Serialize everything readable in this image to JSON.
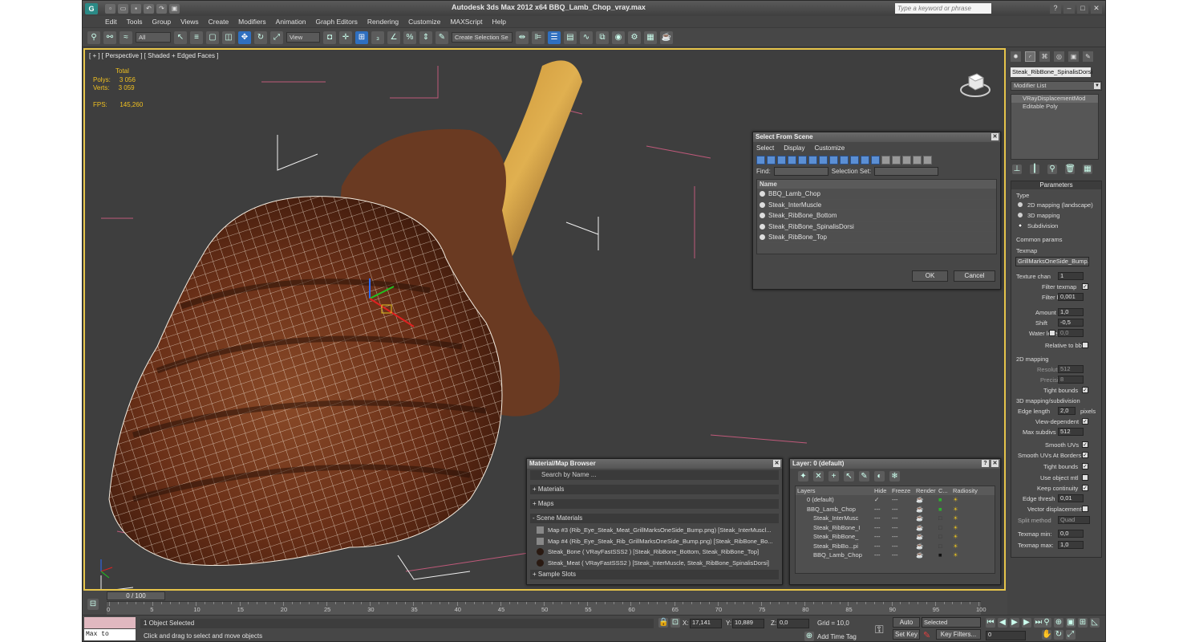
{
  "app": {
    "title": "Autodesk 3ds Max  2012 x64     BBQ_Lamb_Chop_vray.max",
    "search_placeholder": "Type a keyword or phrase",
    "logo_letter": "G"
  },
  "menu": [
    "Edit",
    "Tools",
    "Group",
    "Views",
    "Create",
    "Modifiers",
    "Animation",
    "Graph Editors",
    "Rendering",
    "Customize",
    "MAXScript",
    "Help"
  ],
  "toolbar": {
    "filter_select": "All",
    "ref_coord": "View",
    "named_selection": "Create Selection Se"
  },
  "viewport": {
    "label": "[ + ] [ Perspective ] [ Shaded + Edged Faces ]",
    "stats": {
      "total_label": "Total",
      "polys_label": "Polys:",
      "polys_value": "3 056",
      "verts_label": "Verts:",
      "verts_value": "3 059",
      "fps_label": "FPS:",
      "fps_value": "145,260"
    }
  },
  "select_from_scene": {
    "title": "Select From Scene",
    "menu": [
      "Select",
      "Display",
      "Customize"
    ],
    "find_label": "Find:",
    "selection_set_label": "Selection Set:",
    "column_name": "Name",
    "items": [
      "BBQ_Lamb_Chop",
      "Steak_InterMuscle",
      "Steak_RibBone_Bottom",
      "Steak_RibBone_SpinalisDorsi",
      "Steak_RibBone_Top"
    ],
    "ok": "OK",
    "cancel": "Cancel"
  },
  "material_browser": {
    "title": "Material/Map Browser",
    "search": "Search by Name ...",
    "groups": [
      "+ Materials",
      "+ Maps",
      "- Scene Materials"
    ],
    "scene_materials": [
      "Map #3 (Rib_Eye_Steak_Meat_GrillMarksOneSide_Bump.png) [Steak_InterMuscl...",
      "Map #4 (Rib_Eye_Steak_Rib_GrillMarksOneSide_Bump.png) [Steak_RibBone_Bo...",
      "Steak_Bone  ( VRayFastSSS2 )  [Steak_RibBone_Bottom, Steak_RibBone_Top]",
      "Steak_Meat  ( VRayFastSSS2 )  [Steak_InterMuscle, Steak_RibBone_SpinalisDorsi]"
    ],
    "sample_slots": "+ Sample Slots"
  },
  "layer_manager": {
    "title": "Layer: 0 (default)",
    "columns": [
      "Layers",
      "Hide",
      "Freeze",
      "Render",
      "C...",
      "Radiosity"
    ],
    "rows": [
      "0 (default)",
      "BBQ_Lamb_Chop",
      "Steak_InterMusc",
      "Steak_RibBone_I",
      "Steak_RibBone_",
      "Steak_RibBo...pi",
      "BBQ_Lamb_Chop"
    ]
  },
  "command_panel": {
    "object_name": "Steak_RibBone_SpinalisDorsi",
    "modifier_list": "Modifier List",
    "stack": [
      "VRayDisplacementMod",
      "Editable Poly"
    ],
    "parameters": {
      "header": "Parameters",
      "type_label": "Type",
      "types": [
        "2D mapping (landscape)",
        "3D mapping",
        "Subdivision"
      ],
      "common": "Common params",
      "texmap_label": "Texmap",
      "texmap_value": "GrillMarksOneSide_Bump.png)",
      "texture_chan": "Texture chan",
      "texture_chan_val": "1",
      "filter_texmap": "Filter texmap",
      "filter_blur": "Filter blur",
      "filter_blur_val": "0,001",
      "amount": "Amount",
      "amount_val": "1,0",
      "shift": "Shift",
      "shift_val": "-0,5",
      "water_level": "Water level",
      "water_level_val": "0,0",
      "relative_bbox": "Relative to bbox",
      "mapping2d": "2D mapping",
      "resolution": "Resolution",
      "resolution_val": "512",
      "precision": "Precision",
      "precision_val": "8",
      "tight_bounds": "Tight bounds",
      "mapping3d": "3D mapping/subdivision",
      "edge_length": "Edge length",
      "edge_length_val": "2,0",
      "pixels": "pixels",
      "view_dependent": "View-dependent",
      "max_subdivs": "Max subdivs",
      "max_subdivs_val": "512",
      "smooth_uvs": "Smooth UVs",
      "smooth_uvs_borders": "Smooth UVs At Borders",
      "tight_bounds2": "Tight bounds",
      "use_object_mtl": "Use object mtl",
      "keep_continuity": "Keep continuity",
      "edge_thresh": "Edge thresh",
      "edge_thresh_val": "0,01",
      "vector_disp": "Vector displacement",
      "split_method": "Split method",
      "split_method_val": "Quad",
      "texmap_min": "Texmap min:",
      "texmap_min_val": "0,0",
      "texmap_max": "Texmap max:",
      "texmap_max_val": "1,0"
    }
  },
  "timeline": {
    "frame": "0 / 100",
    "ticks": [
      "0",
      "5",
      "10",
      "15",
      "20",
      "25",
      "30",
      "35",
      "40",
      "45",
      "50",
      "55",
      "60",
      "65",
      "70",
      "75",
      "80",
      "85",
      "90",
      "95",
      "100"
    ]
  },
  "status": {
    "maxscript": "Max to Physc.",
    "selected": "1 Object Selected",
    "prompt": "Click and drag to select and move objects",
    "x_label": "X:",
    "x_val": "17,141",
    "y_label": "Y:",
    "y_val": "10,889",
    "z_label": "Z:",
    "z_val": "0,0",
    "grid": "Grid = 10,0",
    "add_time_tag": "Add Time Tag",
    "auto_key": "Auto Key",
    "set_key": "Set Key",
    "selected_dropdown": "Selected",
    "key_filters": "Key Filters...",
    "frame_field": "0"
  }
}
